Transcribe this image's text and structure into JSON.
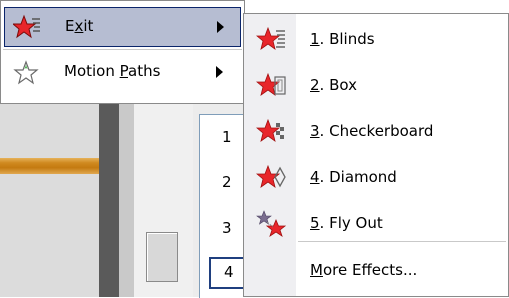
{
  "menu": {
    "items": [
      {
        "label_pre": "E",
        "label_key": "x",
        "label_post": "it",
        "icon": "red-star-icon",
        "has_submenu": true
      },
      {
        "label_pre": "Motion ",
        "label_key": "P",
        "label_post": "aths",
        "icon": "outline-star-icon",
        "has_submenu": true
      }
    ]
  },
  "submenu": {
    "items": [
      {
        "num": "1",
        "sep": ".",
        "text": " Blinds",
        "icon": "blinds-effect-icon"
      },
      {
        "num": "2",
        "sep": ".",
        "text": " Box",
        "icon": "box-effect-icon"
      },
      {
        "num": "3",
        "sep": ".",
        "text": " Checkerboard",
        "icon": "checkerboard-effect-icon"
      },
      {
        "num": "4",
        "sep": ".",
        "text": " Diamond",
        "icon": "diamond-effect-icon"
      },
      {
        "num": "5",
        "sep": ".",
        "text": " Fly Out",
        "icon": "fly-out-effect-icon"
      }
    ],
    "more_pre": "",
    "more_key": "M",
    "more_post": "ore Effects..."
  },
  "slides": {
    "numbers": [
      "1",
      "2",
      "3",
      "4"
    ],
    "selected": "4"
  },
  "colors": {
    "highlight": "#b6bdd2",
    "highlight_border": "#0a246a",
    "star_red": "#e8262b",
    "accent_orange": "#d08a20"
  }
}
